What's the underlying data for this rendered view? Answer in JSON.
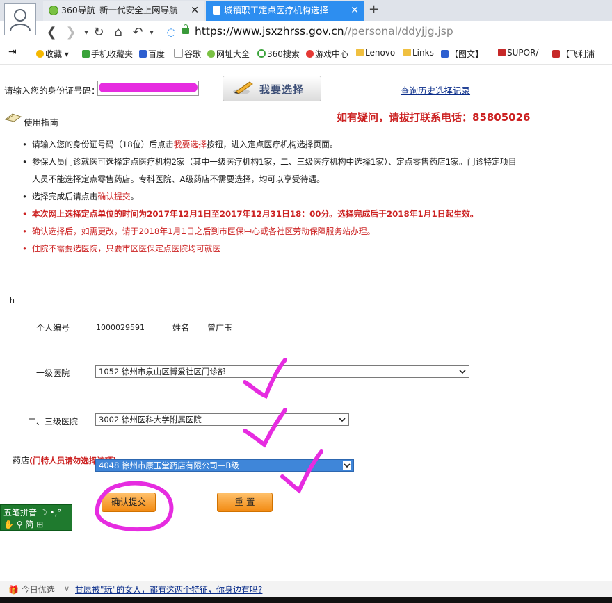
{
  "browser": {
    "tabs": [
      {
        "label": "360导航_新一代安全上网导航"
      },
      {
        "label": "城镇职工定点医疗机构选择"
      }
    ],
    "new_tab": "+",
    "url_host": "https://www.jsxzhrss.gov.cn",
    "url_path": "//personal/ddyjjg.jsp",
    "bookmarks": [
      "收藏",
      "手机收藏夹",
      "百度",
      "谷歌",
      "网址大全",
      "360搜索",
      "游戏中心",
      "Lenovo",
      "Links",
      "【图文】",
      "SUPOR/",
      "【飞利浦"
    ]
  },
  "form": {
    "id_label": "请输入您的身份证号码：",
    "choose_button": "我要选择",
    "history_link": "查询历史选择记录",
    "guide_title": "使用指南",
    "hotline": "如有疑问，请拔打联系电话：85805026"
  },
  "guide": {
    "item1_a": "请输入您的身份证号码（18位）后点击",
    "item1_red": "我要选择",
    "item1_b": "按钮，进入定点医疗机构选择页面。",
    "item2_line1": "参保人员门诊就医可选择定点医疗机构2家（其中一级医疗机构1家，二、三级医疗机构中选择1家）、定点零售药店1家。门诊特定项目",
    "item2_line2": "人员不能选择定点零售药店。专科医院、A级药店不需要选择，均可以享受待遇。",
    "item3_a": "选择完成后请点击",
    "item3_red": "确认提交",
    "item3_b": "。",
    "item4": "本次网上选择定点单位的时间为2017年12月1日至2017年12月31日18：00分。选择完成后于2018年1月1日起生效。",
    "item5": "确认选择后，如需更改，请于2018年1月1日之后到市医保中心或各社区劳动保障服务站办理。",
    "item6": "住院不需要选医院，只要市区医保定点医院均可就医"
  },
  "stray_char": "h",
  "person": {
    "id_label": "个人编号",
    "id_value": "1000029591",
    "name_label": "姓名",
    "name_value": "曾广玉"
  },
  "selections": {
    "level1_label": "一级医院",
    "level1_value": "1052  徐州市泉山区博爱社区门诊部",
    "level23_label": "二、三级医院",
    "level23_value": "3002  徐州医科大学附属医院",
    "pharmacy_label": "药店",
    "pharmacy_note": "(门特人员请勿选择该项)",
    "pharmacy_value": "4048  徐州市康玉堂药店有限公司—B级"
  },
  "actions": {
    "confirm": "确认提交",
    "reset": "重  置"
  },
  "ime": {
    "row1": "五笔拼音  ☽ •,°",
    "row2": "简  ⊞"
  },
  "footer": {
    "today": "今日优选",
    "headline": "甘愿被\"玩\"的女人，都有这两个特征，你身边有吗?"
  },
  "colors": {
    "accent_red": "#cc2222",
    "tab_active": "#2d8ef0",
    "button_orange": "#f28a12",
    "annotation_magenta": "#e62ce0"
  }
}
